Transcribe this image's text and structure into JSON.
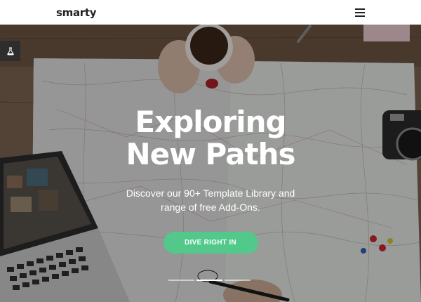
{
  "header": {
    "logo_text": "smarty",
    "menu_icon": "hamburger-menu-icon"
  },
  "hero": {
    "headline_line1": "Exploring",
    "headline_line2": "New Paths",
    "subtitle_line1": "Discover our 90+ Template Library and",
    "subtitle_line2": "range of free Add-Ons.",
    "cta_label": "DIVE RIGHT IN",
    "cta_color": "#52c98a",
    "side_tool_icon": "flask-icon",
    "slides": [
      {
        "active": false
      },
      {
        "active": true
      },
      {
        "active": false
      }
    ]
  }
}
